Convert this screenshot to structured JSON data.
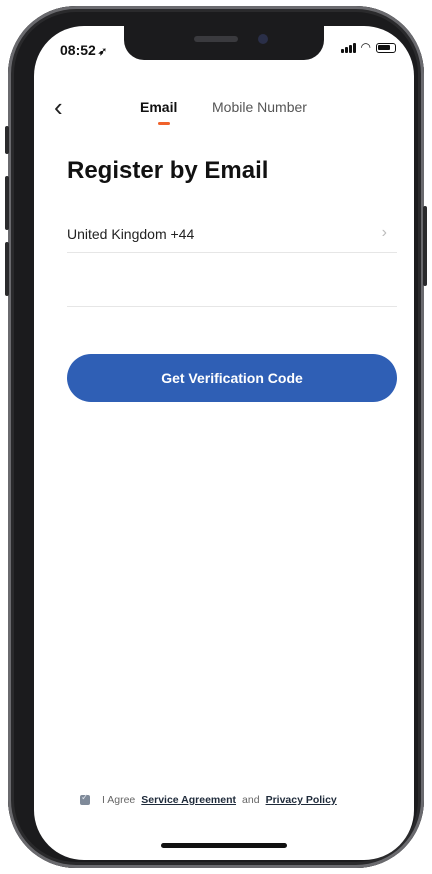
{
  "status_bar": {
    "time": "08:52",
    "location_glyph": "➶"
  },
  "nav": {
    "back_glyph": "‹"
  },
  "tabs": [
    {
      "label": "Email",
      "active": true
    },
    {
      "label": "Mobile Number",
      "active": false
    }
  ],
  "page": {
    "title": "Register by Email",
    "country_label": "United Kingdom +44",
    "chevron_glyph": "›",
    "email_placeholder": "",
    "cta_label": "Get Verification Code"
  },
  "agreement": {
    "prefix": "I Agree",
    "service_link": "Service Agreement",
    "and_text": "and",
    "privacy_link": "Privacy Policy",
    "checked": true
  },
  "colors": {
    "accent_tab": "#f0622b",
    "cta": "#2f5fb5"
  }
}
